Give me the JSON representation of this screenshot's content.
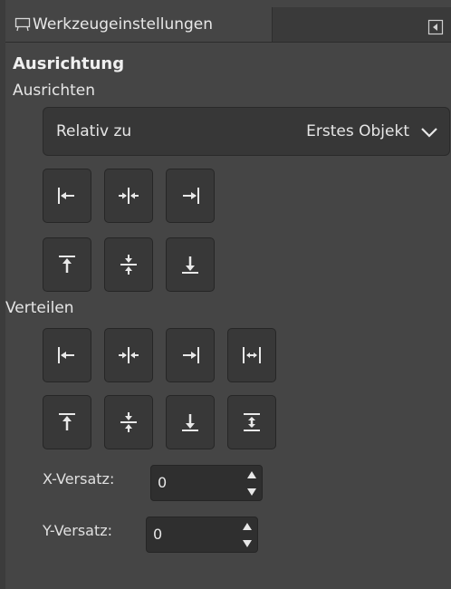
{
  "tab": {
    "title": "Werkzeugeinstellungen",
    "icon": "tool-options-icon"
  },
  "panel_menu_icon": "panel-menu-icon",
  "section_title": "Ausrichtung",
  "align": {
    "heading": "Ausrichten",
    "relative_label": "Relativ zu",
    "relative_value": "Erstes Objekt",
    "row1": [
      "align-left-edge-icon",
      "align-center-horizontal-icon",
      "align-right-edge-icon"
    ],
    "row2": [
      "align-top-edge-icon",
      "align-middle-vertical-icon",
      "align-bottom-edge-icon"
    ]
  },
  "distribute": {
    "heading": "Verteilen",
    "row1": [
      "distribute-left-edges-icon",
      "distribute-horizontal-centers-icon",
      "distribute-right-edges-icon",
      "distribute-horizontal-gaps-icon"
    ],
    "row2": [
      "distribute-top-edges-icon",
      "distribute-vertical-centers-icon",
      "distribute-bottom-edges-icon",
      "distribute-vertical-gaps-icon"
    ]
  },
  "offset": {
    "x_label": "X-Versatz:",
    "x_value": "0",
    "y_label": "Y-Versatz:",
    "y_value": "0"
  },
  "colors": {
    "background": "#454545",
    "button": "#383838",
    "icon": "#e8e8e8"
  }
}
